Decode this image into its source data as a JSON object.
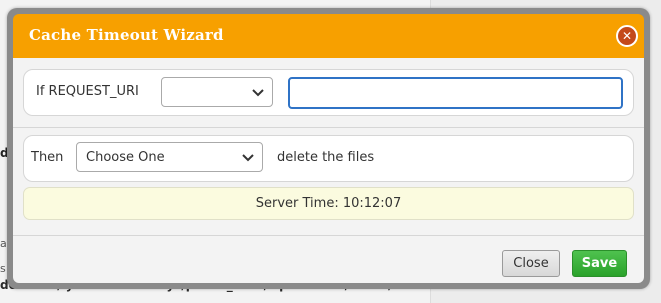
{
  "background": {
    "fragments": [
      "do",
      "ave",
      "s v",
      "do"
    ],
    "bottom_path": "domains/ your-website.xyz/public_html/wp-content/cache/all"
  },
  "dialog": {
    "title": "Cache Timeout Wizard",
    "close_icon": "close-icon",
    "row1": {
      "label": "If REQUEST_URI",
      "select_value": "",
      "input_value": ""
    },
    "row2": {
      "label": "Then",
      "select_value": "Choose One",
      "suffix": "delete the files"
    },
    "server_time": "Server Time: 10:12:07",
    "buttons": {
      "close": "Close",
      "save": "Save"
    },
    "colors": {
      "titlebar": "#f7a000",
      "save": "#2aa22a",
      "input_focus": "#2f73c6",
      "server_time_bg": "#fbfbdf"
    }
  }
}
